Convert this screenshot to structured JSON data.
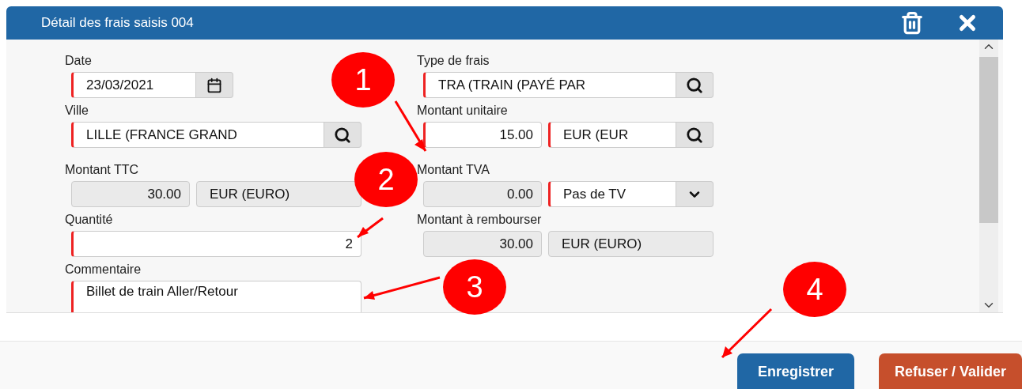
{
  "dialog": {
    "title": "Détail des frais saisis 004"
  },
  "left_column": [
    {
      "label": "Date",
      "inputs": [
        {
          "value": "23/03/2021",
          "kind": "text",
          "required": true,
          "readonly": false
        }
      ],
      "kind": "calendar"
    },
    {
      "label": "Ville",
      "inputs": [
        {
          "value": "LILLE (FRANCE GRAND",
          "kind": "text",
          "required": true,
          "readonly": false
        }
      ],
      "kind": "search"
    },
    {
      "label": "Montant TTC",
      "inputs": [
        {
          "value": "30.00",
          "kind": "number",
          "required": false,
          "readonly": true
        },
        {
          "value": "EUR (EURO)",
          "kind": "text",
          "required": false,
          "readonly": true
        }
      ]
    },
    {
      "label": "Quantité",
      "inputs": [
        {
          "value": "2",
          "kind": "number",
          "required": true,
          "readonly": false
        }
      ]
    },
    {
      "label": "Commentaire",
      "inputs": [
        {
          "value": "Billet de train Aller/Retour",
          "kind": "multiline",
          "required": true,
          "readonly": false
        }
      ]
    }
  ],
  "right_column": [
    {
      "label": "Type de frais",
      "inputs": [
        {
          "value": "TRA (TRAIN (PAYÉ PAR",
          "kind": "text",
          "required": true,
          "readonly": false
        }
      ],
      "kind": "search"
    },
    {
      "label": "Montant unitaire",
      "inputs": [
        {
          "value": "15.00",
          "kind": "number",
          "required": true,
          "readonly": false
        },
        {
          "value": "EUR (EUR",
          "kind": "text",
          "required": true,
          "readonly": false
        }
      ],
      "kind": "search"
    },
    {
      "label": "Montant TVA",
      "inputs": [
        {
          "value": "0.00",
          "kind": "number",
          "required": false,
          "readonly": true
        },
        {
          "value": "Pas de TV",
          "kind": "text",
          "required": true,
          "readonly": false
        }
      ],
      "kind": "dropdown"
    },
    {
      "label": "Montant à rembourser",
      "inputs": [
        {
          "value": "30.00",
          "kind": "number",
          "required": false,
          "readonly": true
        },
        {
          "value": "EUR (EURO)",
          "kind": "text",
          "required": false,
          "readonly": true
        }
      ]
    }
  ],
  "buttons": [
    {
      "label": "Enregistrer",
      "kind": "primary"
    },
    {
      "label": "Refuser / Valider",
      "kind": "danger"
    }
  ],
  "callouts": [
    {
      "label": "1"
    },
    {
      "label": "2"
    },
    {
      "label": "3"
    },
    {
      "label": "4"
    }
  ]
}
